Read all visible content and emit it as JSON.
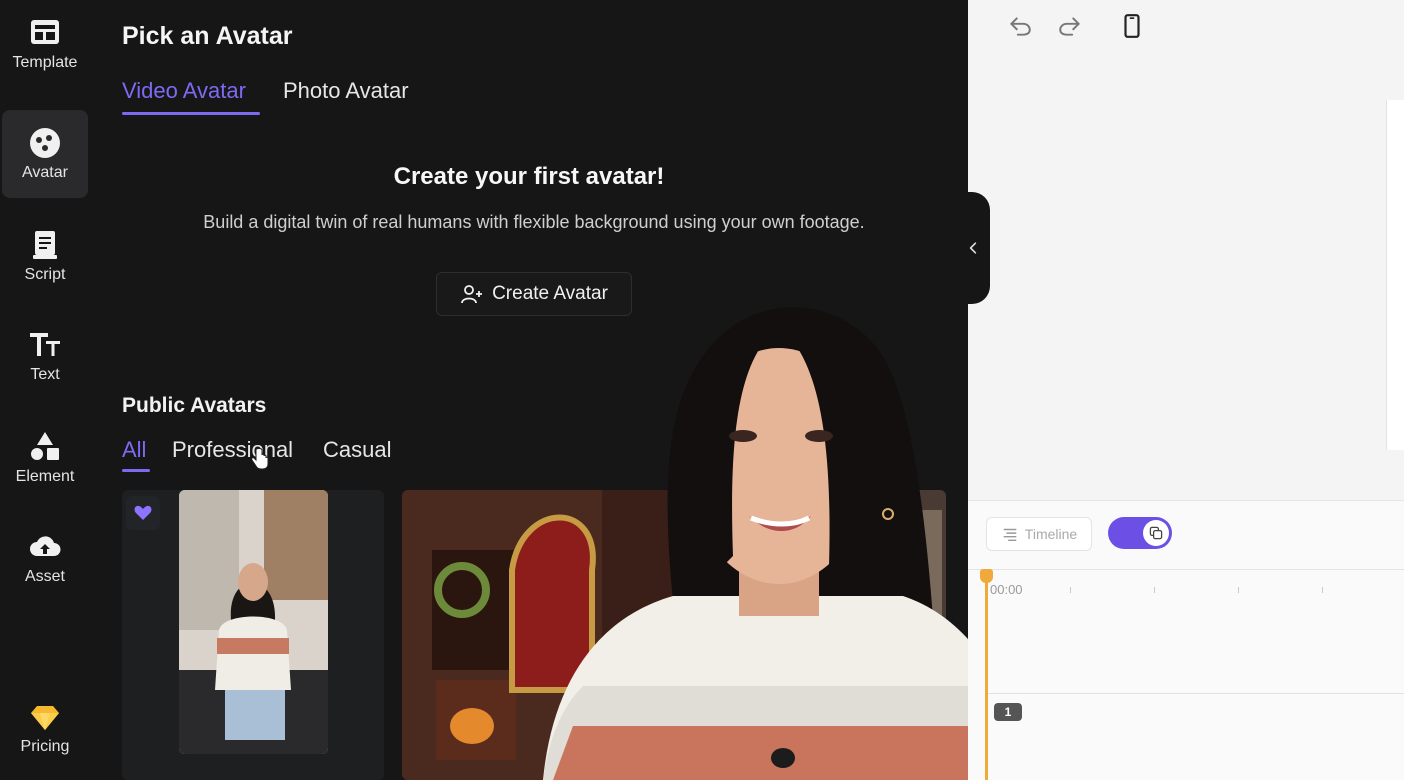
{
  "sidebar": {
    "items": [
      {
        "label": "Template",
        "icon": "template-icon"
      },
      {
        "label": "Avatar",
        "icon": "avatar-icon",
        "active": true
      },
      {
        "label": "Script",
        "icon": "script-icon"
      },
      {
        "label": "Text",
        "icon": "text-icon"
      },
      {
        "label": "Element",
        "icon": "element-icon"
      },
      {
        "label": "Asset",
        "icon": "cloud-upload-icon"
      }
    ],
    "pricing": {
      "label": "Pricing",
      "icon": "diamond-icon"
    }
  },
  "panel": {
    "title": "Pick an Avatar",
    "tabs": [
      {
        "label": "Video Avatar",
        "active": true
      },
      {
        "label": "Photo Avatar",
        "active": false
      }
    ],
    "hero": {
      "title": "Create your first avatar!",
      "description": "Build a digital twin of real humans with flexible background using your own footage.",
      "button_label": "Create Avatar"
    },
    "public": {
      "title": "Public Avatars",
      "filters": [
        {
          "label": "All",
          "active": true
        },
        {
          "label": "Professional",
          "active": false
        },
        {
          "label": "Casual",
          "active": false
        }
      ]
    }
  },
  "editor": {
    "timeline_label": "Timeline",
    "time_start": "00:00",
    "track_number": "1"
  },
  "colors": {
    "accent": "#7d6af3",
    "toggle": "#6c50e6",
    "playhead": "#f0a93a",
    "background": "#161616"
  }
}
